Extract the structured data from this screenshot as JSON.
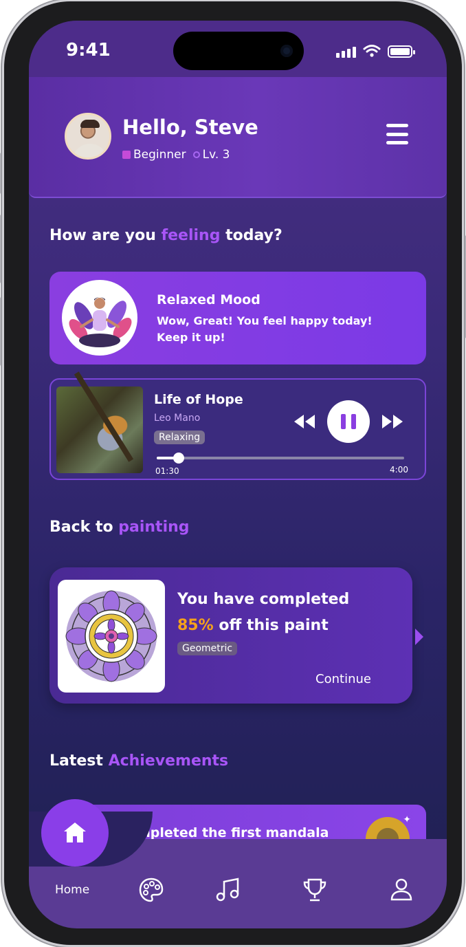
{
  "status_bar": {
    "time": "9:41"
  },
  "header": {
    "greeting": "Hello, Steve",
    "level_name": "Beginner",
    "level_number": "Lv. 3"
  },
  "mood_section": {
    "title_pre": "How are you ",
    "title_highlight": "feeling",
    "title_post": " today?"
  },
  "mood_card": {
    "title": "Relaxed Mood",
    "message": "Wow, Great! You feel happy today! Keep it up!"
  },
  "music_player": {
    "song_title": "Life of Hope",
    "artist": "Leo Mano",
    "tag": "Relaxing",
    "current_time": "01:30",
    "total_time": "4:00",
    "progress": 0.09
  },
  "painting_section": {
    "title_pre": "Back to ",
    "title_highlight": "painting"
  },
  "paint_card": {
    "line1": "You have completed",
    "percent": "85%",
    "line2_post": " off this paint",
    "tag": "Geometric",
    "action": "Continue"
  },
  "achievements_section": {
    "title_pre": "Latest ",
    "title_highlight": "Achievements"
  },
  "achievement_card": {
    "text": "Completed the first mandala"
  },
  "bottom_nav": {
    "home_label": "Home",
    "items": [
      "home-icon",
      "palette-icon",
      "music-icon",
      "trophy-icon",
      "profile-icon"
    ]
  },
  "colors": {
    "accent": "#a855f7",
    "highlight_orange": "#f5a21a",
    "card_purple": "#8a3ee0"
  }
}
